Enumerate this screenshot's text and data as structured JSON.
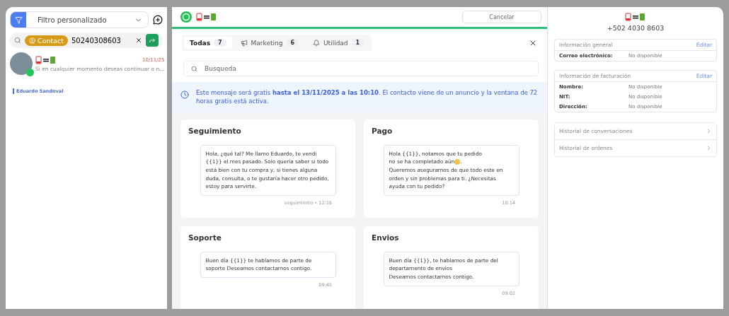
{
  "sidebar": {
    "filter": {
      "value": "Filtro personalizado"
    },
    "search": {
      "chip": "Contact",
      "value": "50240308603"
    },
    "chats": [
      {
        "date": "10/11/25",
        "preview": "Si en cualquier momento deseas continuar o n...",
        "agent": "Eduardo Sandoval"
      }
    ]
  },
  "header": {
    "cancel_button": "Cancelar"
  },
  "tabs": [
    {
      "label": "Todas",
      "count": "7",
      "selected": true,
      "kind": "all"
    },
    {
      "label": "Marketing",
      "count": "6",
      "selected": false,
      "kind": "marketing"
    },
    {
      "label": "Utilidad",
      "count": "1",
      "selected": false,
      "kind": "utility"
    }
  ],
  "search": {
    "placeholder": "Busqueda"
  },
  "banner": "Este mensaje será gratis **hasta el 13/11/2025 a las 10:10**. El contacto viene de un anuncio y la ventana de 72 horas gratis está activa.",
  "templates": [
    {
      "title": "Seguimiento",
      "body": "Hola, ¿qué tal? Me llamo Eduardo, te vendi {{1}} el mes pasado. Solo quería saber si todo está bien con tu compra y, si tienes alguna duda, consulta, o te gustaría hacer otro pedido, estoy para servirte.",
      "meta": "seguimiento • 12:16"
    },
    {
      "title": "Pago",
      "body": "Hola {{1}}, notamos que tu pedido\nno se ha completado aún",
      "emoji": true,
      "body_after": ".\nQueremos asegurarnos de que todo este en orden y sin problemas para ti. ¿Necesitas ayuda con tu pedido?",
      "meta": "10:14"
    },
    {
      "title": "Soporte",
      "body": "Buen día {{1}} te hablamos de parte de soporte  Deseamos contactarnos contigo.",
      "meta": "09:45"
    },
    {
      "title": "Envios",
      "body": "Buen día {{1}}, te hablamos de parte del departamento de envios\nDeseamos contactarnos contigo.",
      "meta": "09:02"
    }
  ],
  "contact": {
    "phone": "+502 4030 8603",
    "sections": [
      {
        "title": "Información general",
        "edit": "Editar",
        "fields": [
          {
            "label": "Correo electrónico:",
            "value": "No disponible"
          }
        ]
      },
      {
        "title": "Información de facturación",
        "edit": "Editar",
        "fields": [
          {
            "label": "Nombre:",
            "value": "No disponible"
          },
          {
            "label": "NIT:",
            "value": "No disponible"
          },
          {
            "label": "Dirección:",
            "value": "No disponible"
          }
        ]
      }
    ],
    "links": [
      "Historial de conversaciones",
      "Historial de ordenes"
    ]
  }
}
